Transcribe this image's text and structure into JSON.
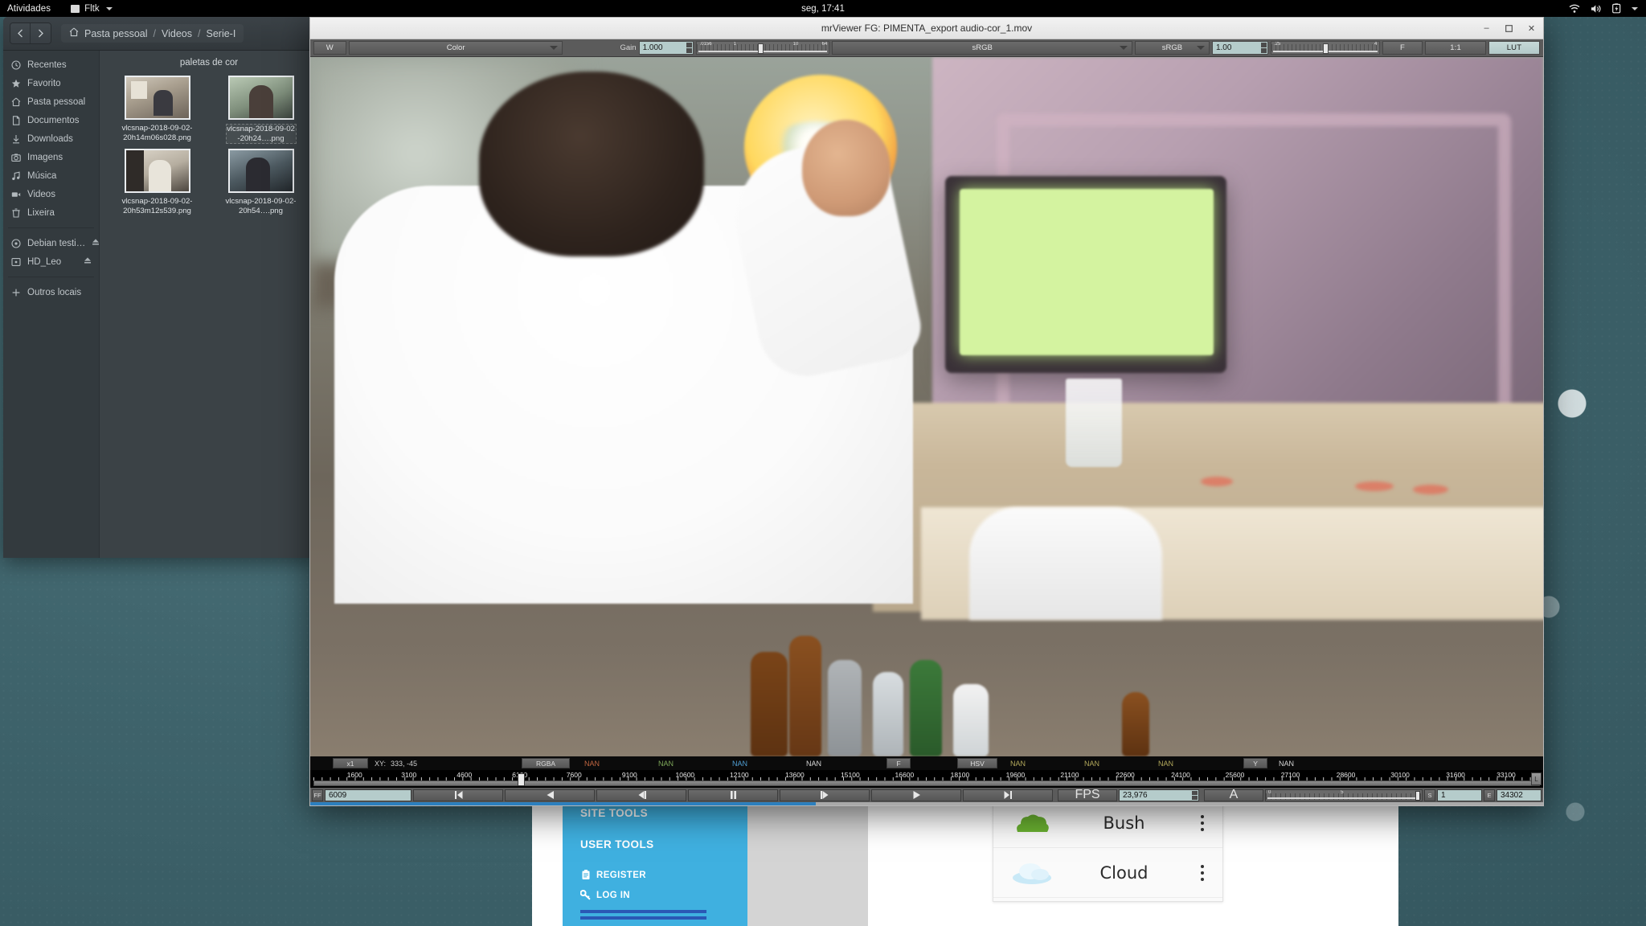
{
  "desktop": {
    "topbar": {
      "activities": "Atividades",
      "app_name": "Fltk",
      "clock": "seg, 17:41",
      "tray_icons": [
        "wifi-icon",
        "volume-icon",
        "battery-icon",
        "chevron-down-icon"
      ]
    },
    "wallpaper_color": "#3f646c"
  },
  "file_manager": {
    "nav": {
      "back": "‹",
      "forward": "›"
    },
    "breadcrumb": [
      "Pasta pessoal",
      "Videos",
      "Serie-I"
    ],
    "places": [
      {
        "label": "Recentes",
        "icon": "clock-icon"
      },
      {
        "label": "Favorito",
        "icon": "star-icon"
      },
      {
        "label": "Pasta pessoal",
        "icon": "home-icon"
      },
      {
        "label": "Documentos",
        "icon": "document-icon"
      },
      {
        "label": "Downloads",
        "icon": "download-icon"
      },
      {
        "label": "Imagens",
        "icon": "camera-icon"
      },
      {
        "label": "Música",
        "icon": "music-icon"
      },
      {
        "label": "Videos",
        "icon": "video-icon"
      },
      {
        "label": "Lixeira",
        "icon": "trash-icon"
      }
    ],
    "devices": [
      {
        "label": "Debian testi…",
        "icon": "disc-icon",
        "eject": "eject-icon"
      },
      {
        "label": "HD_Leo",
        "icon": "drive-icon",
        "eject": "eject-icon"
      }
    ],
    "other_locations": {
      "label": "Outros locais",
      "icon": "plus-icon"
    },
    "folder_title": "paletas de cor",
    "files": [
      {
        "name": "vlcsnap-2018-09-02-20h14m06s028.png",
        "thumb": "t1"
      },
      {
        "name": "vlcsnap-2018-09-02-20h24….png",
        "thumb": "t2"
      },
      {
        "name": "vlcsnap-2018-09-02-20h53m12s539.png",
        "thumb": "t3"
      },
      {
        "name": "vlcsnap-2018-09-02-20h54….png",
        "thumb": "t4"
      }
    ]
  },
  "mrviewer": {
    "title": "mrViewer   FG: PIMENTA_export audio-cor_1.mov",
    "window_buttons": {
      "minimize": "–",
      "maximize": "❐",
      "close": "✕"
    },
    "toolbar": {
      "channel_button": "W",
      "layer_select": "Color",
      "gain_label": "Gain",
      "gain_value": "1.000",
      "gain_scale": [
        ".0156",
        "1",
        "10",
        "64"
      ],
      "input_colorspace": "sRGB",
      "display_colorspace": "sRGB",
      "gamma_value": "1.00",
      "gamma_scale": [
        ".25",
        "4"
      ],
      "fit_button": "F",
      "zoom_button": "1:1",
      "lut_button": "LUT"
    },
    "status": {
      "zoom": "x1",
      "xy_label": "XY:",
      "xy_value": "333, -45",
      "rgba_button": "RGBA",
      "r": "NAN",
      "g": "NAN",
      "b": "NAN",
      "a": "NAN",
      "f_button": "F",
      "hsv_button": "HSV",
      "h": "NAN",
      "s": "NAN",
      "v": "NAN",
      "y_button": "Y",
      "y": "NAN"
    },
    "timeline": {
      "ticks": [
        "1600",
        "3100",
        "4600",
        "6100",
        "7600",
        "9100",
        "10600",
        "12100",
        "13600",
        "15100",
        "16600",
        "18100",
        "19600",
        "21100",
        "22600",
        "24100",
        "25600",
        "27100",
        "28600",
        "30100",
        "31600",
        "33100"
      ],
      "playhead_frame": "6100",
      "end_button": "L"
    },
    "transport": {
      "frame_tag": "FF",
      "frame_value": "6009",
      "buttons": [
        "go-start-icon",
        "step-back-fast-icon",
        "step-back-icon",
        "pause-icon",
        "step-forward-icon",
        "play-forward-icon",
        "go-end-icon"
      ],
      "fps_label": "FPS",
      "fps_value": "23,976",
      "audio_button": "A",
      "volume_scale": [
        "0",
        "5"
      ],
      "start_tag": "S",
      "start_value": "1",
      "end_tag": "E",
      "end_value": "34302"
    },
    "progress_percent": 41
  },
  "webpage": {
    "site_tools_heading": "SITE TOOLS",
    "user_tools_heading": "USER TOOLS",
    "links": [
      {
        "label": "REGISTER",
        "icon": "clipboard-icon"
      },
      {
        "label": "LOG IN",
        "icon": "key-icon"
      }
    ],
    "accent_color": "#3fb0e0",
    "rule_color": "#2a58b5"
  },
  "list_card": {
    "rows": [
      {
        "label": "Bush",
        "icon": "bush-icon",
        "menu": "kebab-menu-icon"
      },
      {
        "label": "Cloud",
        "icon": "cloud-icon",
        "menu": "kebab-menu-icon"
      }
    ]
  }
}
